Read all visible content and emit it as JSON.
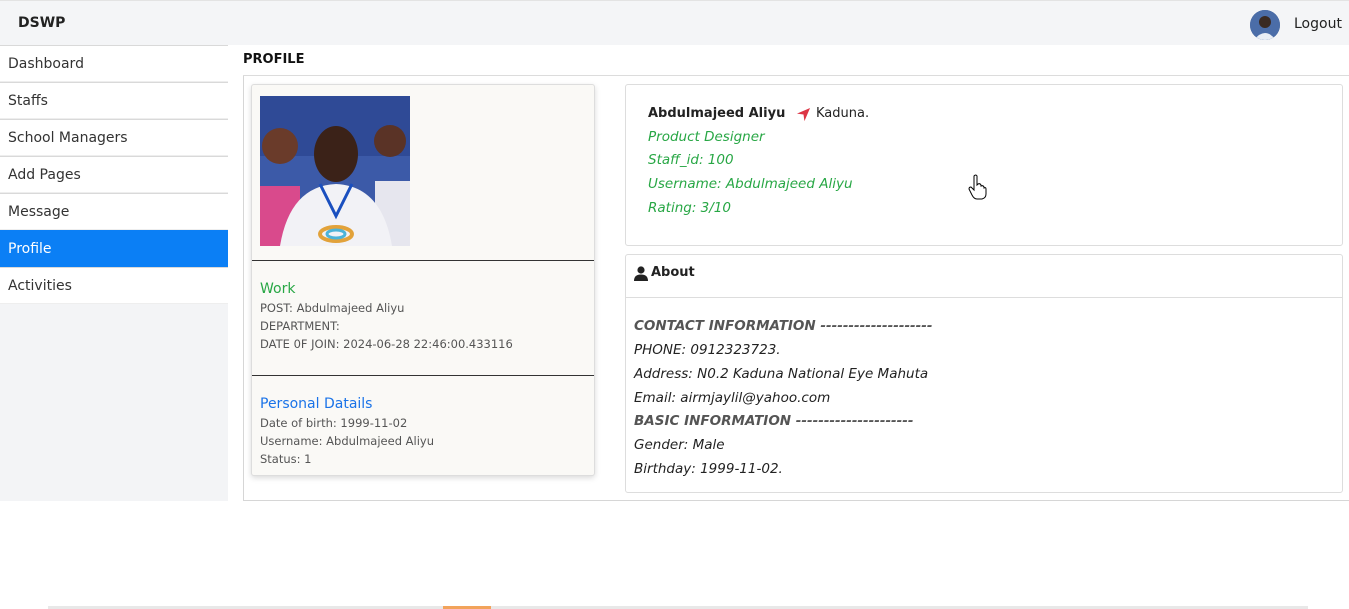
{
  "navbar": {
    "brand": "DSWP",
    "logout_label": "Logout",
    "avatar_icon": "user-avatar-photo"
  },
  "sidebar": {
    "items": [
      {
        "label": "Dashboard"
      },
      {
        "label": "Staffs"
      },
      {
        "label": "School Managers"
      },
      {
        "label": "Add Pages"
      },
      {
        "label": "Message"
      },
      {
        "label": "Profile",
        "active": true
      },
      {
        "label": "Activities"
      }
    ],
    "active_color": "#0b7ff5"
  },
  "page": {
    "title": "PROFILE"
  },
  "profile_card": {
    "work": {
      "title": "Work",
      "post": "POST: Abdulmajeed Aliyu",
      "department": "DEPARTMENT:",
      "date_of_join": "DATE 0F JOIN: 2024-06-28 22:46:00.433116"
    },
    "personal": {
      "title": "Personal Datails",
      "dob": "Date of birth: 1999-11-02",
      "username": "Username: Abdulmajeed Aliyu",
      "status": "Status: 1"
    }
  },
  "info": {
    "name": "Abdulmajeed Aliyu",
    "location": "Kaduna.",
    "location_icon": "location-arrow-icon",
    "role": "Product Designer",
    "staff_id": "Staff_id: 100",
    "username": "Username: Abdulmajeed Aliyu",
    "rating": "Rating: 3/10",
    "accent_color": "#28a745"
  },
  "about": {
    "title": "About",
    "lines": [
      "CONTACT INFORMATION --------------------",
      "PHONE: 0912323723.",
      "Address: N0.2 Kaduna National Eye Mahuta",
      "Email: airmjaylil@yahoo.com",
      "BASIC INFORMATION ---------------------",
      "Gender: Male",
      "Birthday: 1999-11-02."
    ]
  }
}
